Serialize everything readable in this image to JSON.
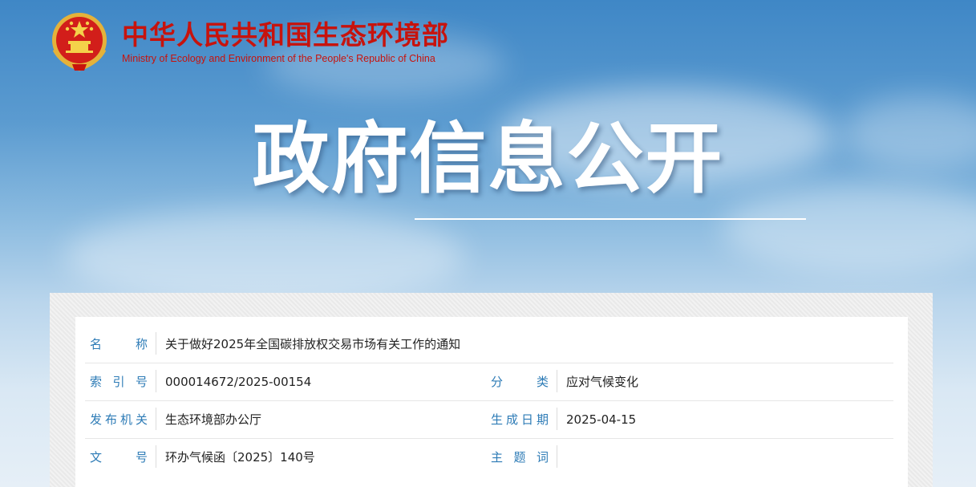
{
  "header": {
    "ministry_name_cn": "中华人民共和国生态环境部",
    "ministry_name_en": "Ministry of Ecology and Environment of the People's Republic of China",
    "emblem_icon": "national-emblem-icon"
  },
  "hero": {
    "title": "政府信息公开"
  },
  "info": {
    "name_label": [
      "名",
      "称"
    ],
    "name_value": "关于做好2025年全国碳排放权交易市场有关工作的通知",
    "index_label": [
      "索",
      "引",
      "号"
    ],
    "index_value": "000014672/2025-00154",
    "category_label": [
      "分",
      "类"
    ],
    "category_value": "应对气候变化",
    "issuer_label": [
      "发",
      "布",
      "机",
      "关"
    ],
    "issuer_value": "生态环境部办公厅",
    "date_label": [
      "生",
      "成",
      "日",
      "期"
    ],
    "date_value": "2025-04-15",
    "doc_no_label": [
      "文",
      "号"
    ],
    "doc_no_value": "环办气候函〔2025〕140号",
    "keywords_label": [
      "主",
      "题",
      "词"
    ],
    "keywords_value": ""
  },
  "colors": {
    "brand_red": "#c7130d",
    "label_blue": "#2d7bb6",
    "sky_top": "#3f87c6",
    "sky_bottom": "#e6eff7"
  }
}
